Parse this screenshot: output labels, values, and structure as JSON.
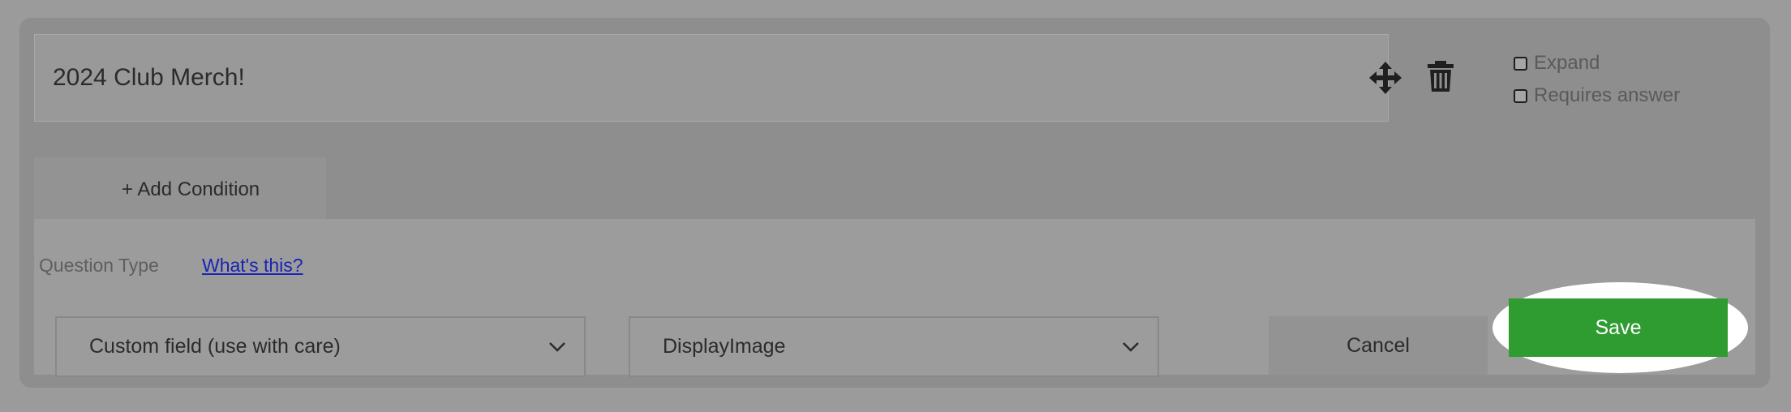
{
  "question": {
    "title": "2024 Club Merch!",
    "move_icon": "move-arrows-icon",
    "delete_icon": "trash-icon",
    "options": {
      "expand_label": "Expand",
      "expand_checked": false,
      "requires_label": "Requires answer",
      "requires_checked": false
    }
  },
  "conditions": {
    "add_label": "+ Add Condition"
  },
  "question_type": {
    "label": "Question Type",
    "help_link": "What's this?",
    "type_select_value": "Custom field (use with care)",
    "field_select_value": "DisplayImage"
  },
  "actions": {
    "cancel_label": "Cancel",
    "save_label": "Save"
  },
  "colors": {
    "save_green": "#2f9c32",
    "link_blue": "#1a23b6",
    "highlight": "#ffffff"
  }
}
